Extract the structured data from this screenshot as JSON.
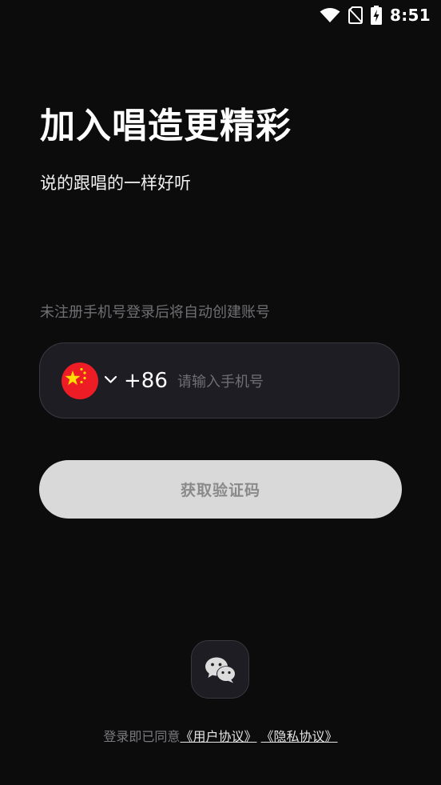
{
  "status_bar": {
    "time": "8:51",
    "icons": [
      "wifi-icon",
      "no-sim-icon",
      "battery-charging-icon"
    ]
  },
  "header": {
    "title": "加入唱造更精彩",
    "subtitle": "说的跟唱的一样好听"
  },
  "login_form": {
    "hint": "未注册手机号登录后将自动创建账号",
    "country_flag_icon": "china-flag-icon",
    "country_code": "+86",
    "phone_placeholder": "请输入手机号",
    "get_code_label": "获取验证码"
  },
  "third_party": {
    "wechat_icon": "wechat-icon"
  },
  "agreement": {
    "prefix": "登录即已同意",
    "user_agreement": "《用户协议》",
    "privacy_policy": "《隐私协议》"
  },
  "colors": {
    "background": "#0c0c0d",
    "input_background": "#1e1d24",
    "button_disabled": "#d9d9d9",
    "flag_red": "#ee1c25",
    "flag_yellow": "#ffde00"
  }
}
